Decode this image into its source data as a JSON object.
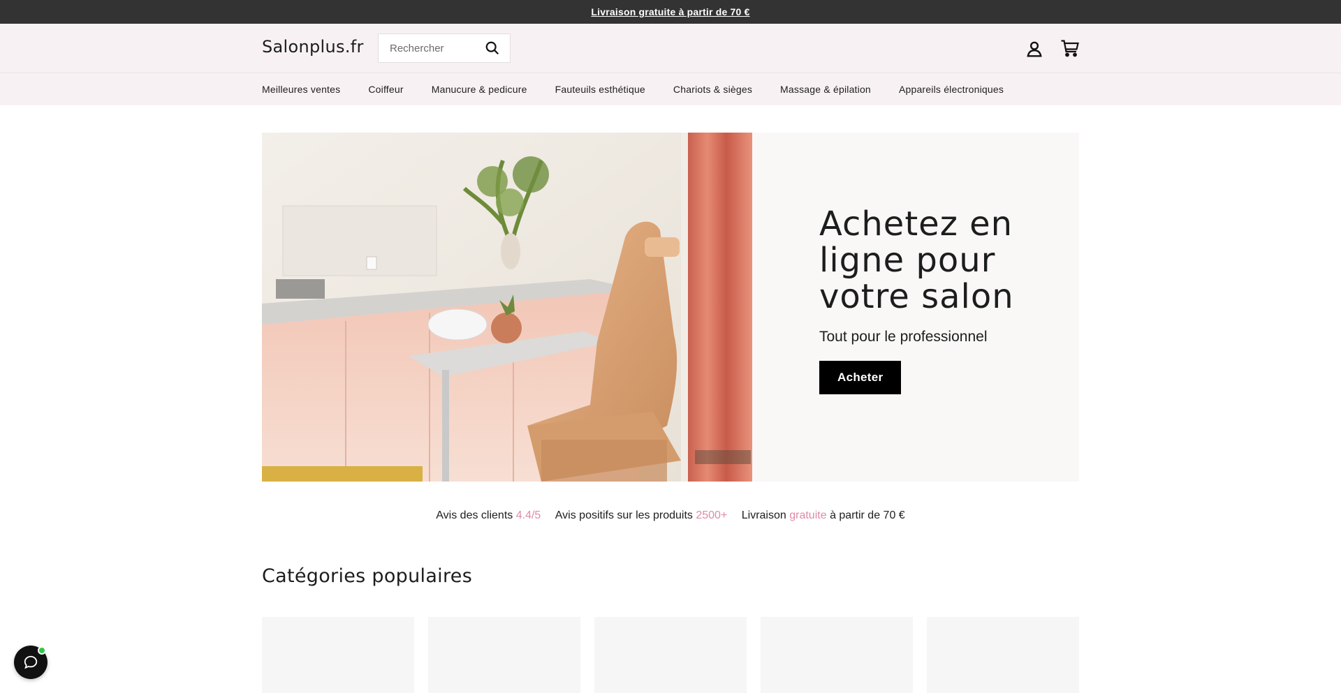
{
  "announcement": {
    "text": "Livraison gratuite à partir de 70 €"
  },
  "header": {
    "logo": "Salonplus.fr",
    "search_placeholder": "Rechercher",
    "icons": {
      "search": "search-icon",
      "account": "user-icon",
      "cart": "cart-icon"
    }
  },
  "nav": {
    "items": [
      {
        "label": "Meilleures ventes"
      },
      {
        "label": "Coiffeur"
      },
      {
        "label": "Manucure & pedicure"
      },
      {
        "label": "Fauteuils esthétique"
      },
      {
        "label": "Chariots & sièges"
      },
      {
        "label": "Massage & épilation"
      },
      {
        "label": "Appareils électroniques"
      }
    ]
  },
  "hero": {
    "title": "Achetez en ligne pour votre salon",
    "subtitle": "Tout pour le professionnel",
    "button": "Acheter"
  },
  "stats": [
    {
      "label": "Avis des clients",
      "value": "4.4/5",
      "suffix": ""
    },
    {
      "label": "Avis positifs sur les produits",
      "value": "2500+",
      "suffix": ""
    },
    {
      "label": "Livraison",
      "value": "gratuite",
      "suffix": "à partir de 70 €"
    }
  ],
  "categories": {
    "title": "Catégories populaires",
    "count_visible": 5
  },
  "colors": {
    "announcement_bg": "#333333",
    "header_bg": "#f8f1f3",
    "accent": "#e18aa6",
    "button_bg": "#000000",
    "chat_status": "#2ec946"
  }
}
